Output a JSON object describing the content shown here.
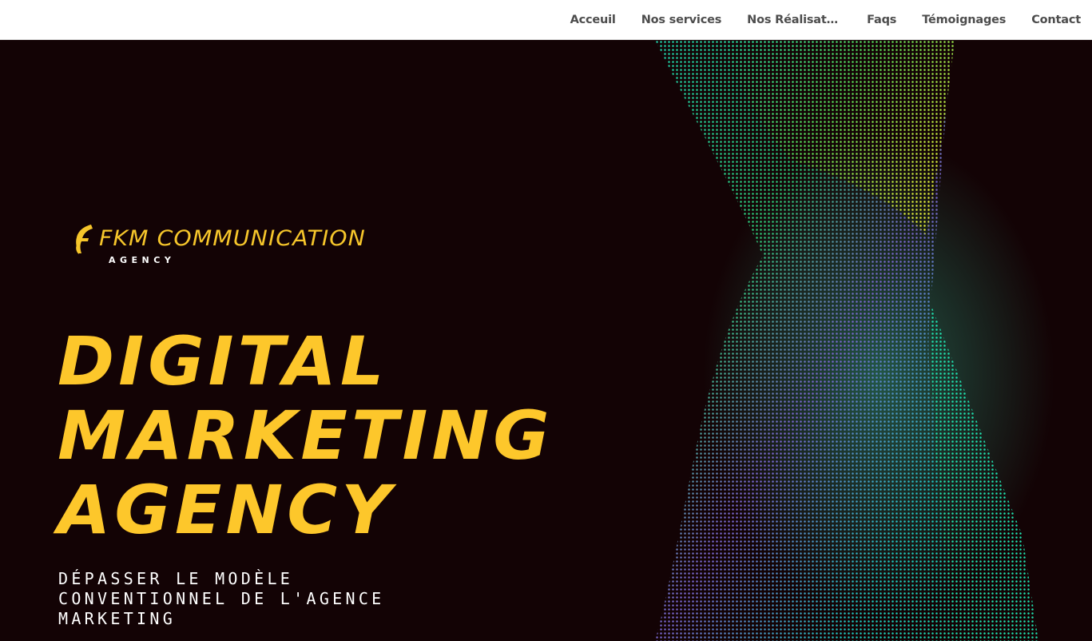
{
  "nav": {
    "items": [
      {
        "label": "Acceuil"
      },
      {
        "label": "Nos services"
      },
      {
        "label": "Nos Réalisations"
      },
      {
        "label": "Faqs"
      },
      {
        "label": "Témoignages"
      },
      {
        "label": "Contact"
      }
    ]
  },
  "hero": {
    "logo": {
      "title": "FKM COMMUNICATION",
      "subtitle": "AGENCY",
      "icon": "flame-f-logo-icon",
      "color": "#f6c62b"
    },
    "headline": {
      "line1": "DIGITAL",
      "line2": "MARKETING",
      "line3": "AGENCY"
    },
    "tagline": "DÉPASSER LE MODÈLE CONVENTIONNEL DE L'AGENCE MARKETING",
    "background_color": "#130305",
    "accent_color": "#fdc72b",
    "wave_colors": [
      "#1fe0a8",
      "#3fd36e",
      "#d8ef3a",
      "#8b63d8",
      "#20c9b8"
    ]
  }
}
